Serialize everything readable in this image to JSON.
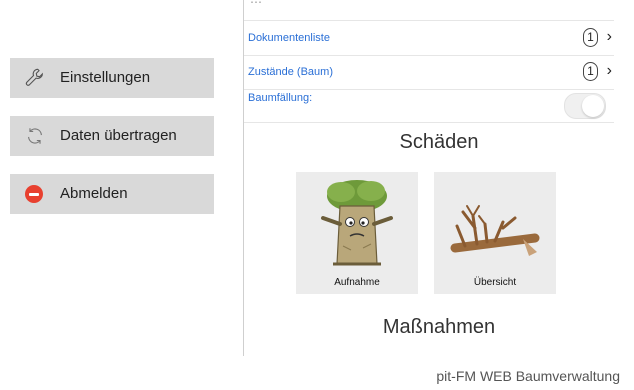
{
  "sidebar": {
    "items": [
      {
        "label": "Einstellungen",
        "icon": "wrench-icon"
      },
      {
        "label": "Daten übertragen",
        "icon": "sync-icon"
      },
      {
        "label": "Abmelden",
        "icon": "minus-circle-icon"
      }
    ]
  },
  "main": {
    "top_faded_text": "⋯",
    "rows": [
      {
        "label": "Dokumentenliste",
        "count": "1"
      },
      {
        "label": "Zustände (Baum)",
        "count": "1"
      }
    ],
    "toggle_row": {
      "label": "Baumfällung:",
      "on": false
    },
    "schaeden_title": "Schäden",
    "tiles": [
      {
        "label": "Aufnahme",
        "icon": "tree-character-icon"
      },
      {
        "label": "Übersicht",
        "icon": "fallen-tree-icon"
      }
    ],
    "massnahmen_title": "Maßnahmen"
  },
  "footer": {
    "text": "pit-FM WEB Baumverwaltung"
  },
  "colors": {
    "link": "#2a6fd6",
    "button_bg": "#d9d9d9",
    "logout_red": "#e8402f",
    "tile_bg": "#ececec"
  }
}
